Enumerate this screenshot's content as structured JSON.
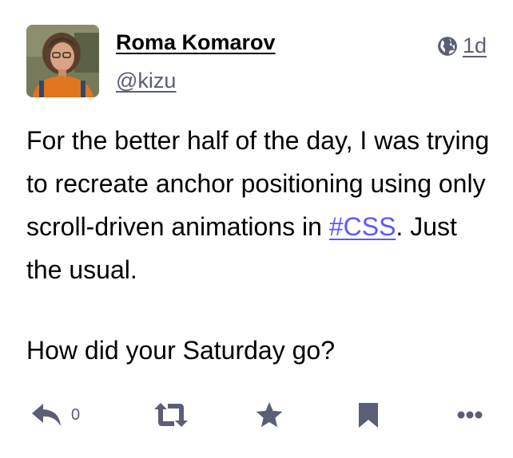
{
  "author": {
    "display_name": "Roma Komarov",
    "handle": "@kizu",
    "avatar_icon": "avatar-photo"
  },
  "meta": {
    "visibility_icon": "globe-icon",
    "timestamp": "1d"
  },
  "content": {
    "paragraph1_text": "For the better half of the day, I was trying to recreate anchor positioning using only scroll-driven animations in ",
    "hashtag": "#CSS",
    "paragraph1_tail": ". Just the usual.",
    "paragraph2_text": "How did your Saturday go?"
  },
  "actions": {
    "reply_icon": "reply-icon",
    "reply_count": "0",
    "boost_icon": "boost-icon",
    "favourite_icon": "star-icon",
    "bookmark_icon": "bookmark-icon",
    "more_icon": "ellipsis-icon"
  },
  "colors": {
    "text": "#000000",
    "muted": "#5b5f75",
    "icon": "#5b5f75",
    "link": "#595aff"
  }
}
